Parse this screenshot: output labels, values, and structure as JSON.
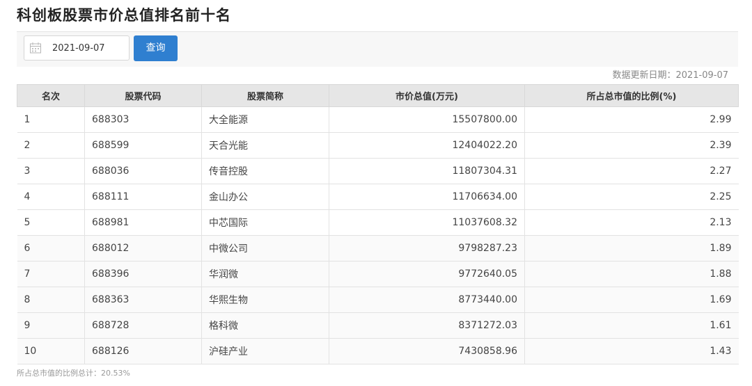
{
  "page": {
    "title": "科创板股票市价总值排名前十名"
  },
  "toolbar": {
    "date_value": "2021-09-07",
    "calendar_icon": "calendar-icon",
    "query_label": "查询"
  },
  "update_info": "数据更新日期：2021-09-07",
  "table": {
    "headers": [
      "名次",
      "股票代码",
      "股票简称",
      "市价总值(万元)",
      "所占总市值的比例(%)"
    ],
    "rows": [
      {
        "rank": "1",
        "code": "688303",
        "name": "大全能源",
        "value": "15507800.00",
        "ratio": "2.99"
      },
      {
        "rank": "2",
        "code": "688599",
        "name": "天合光能",
        "value": "12404022.20",
        "ratio": "2.39"
      },
      {
        "rank": "3",
        "code": "688036",
        "name": "传音控股",
        "value": "11807304.31",
        "ratio": "2.27"
      },
      {
        "rank": "4",
        "code": "688111",
        "name": "金山办公",
        "value": "11706634.00",
        "ratio": "2.25"
      },
      {
        "rank": "5",
        "code": "688981",
        "name": "中芯国际",
        "value": "11037608.32",
        "ratio": "2.13"
      },
      {
        "rank": "6",
        "code": "688012",
        "name": "中微公司",
        "value": "9798287.23",
        "ratio": "1.89"
      },
      {
        "rank": "7",
        "code": "688396",
        "name": "华润微",
        "value": "9772640.05",
        "ratio": "1.88"
      },
      {
        "rank": "8",
        "code": "688363",
        "name": "华熙生物",
        "value": "8773440.00",
        "ratio": "1.69"
      },
      {
        "rank": "9",
        "code": "688728",
        "name": "格科微",
        "value": "8371272.03",
        "ratio": "1.61"
      },
      {
        "rank": "10",
        "code": "688126",
        "name": "沪硅产业",
        "value": "7430858.96",
        "ratio": "1.43"
      }
    ]
  },
  "footer_note": "所占总市值的比例总计：20.53%",
  "colors": {
    "accent": "#2f7fd0",
    "link": "#2f78c4",
    "header_bg": "#e6e6e6"
  }
}
